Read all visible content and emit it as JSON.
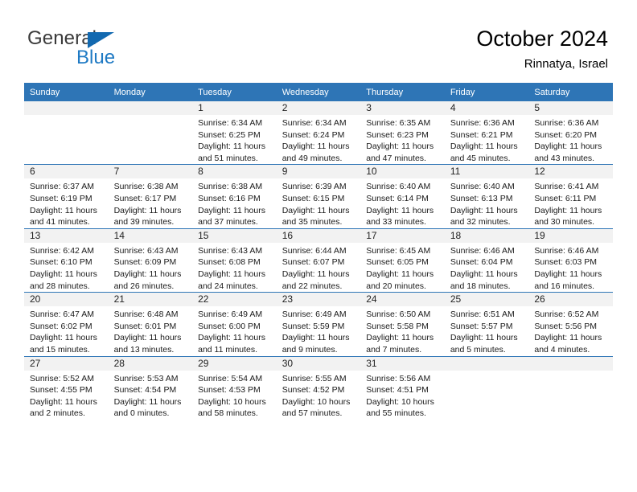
{
  "brand": {
    "name_part1": "General",
    "name_part2": "Blue",
    "triangle_color": "#1269b0",
    "blue_text_color": "#1f7ac4"
  },
  "header": {
    "title": "October 2024",
    "subtitle": "Rinnatya, Israel",
    "accent_color": "#2e75b6",
    "band_color": "#f2f2f2"
  },
  "calendar": {
    "weekday_headers": [
      "Sunday",
      "Monday",
      "Tuesday",
      "Wednesday",
      "Thursday",
      "Friday",
      "Saturday"
    ],
    "weeks": [
      [
        {
          "day": "",
          "empty": true,
          "sunrise": "",
          "sunset": "",
          "daylight_line1": "",
          "daylight_line2": ""
        },
        {
          "day": "",
          "empty": true,
          "sunrise": "",
          "sunset": "",
          "daylight_line1": "",
          "daylight_line2": ""
        },
        {
          "day": "1",
          "empty": false,
          "sunrise": "Sunrise: 6:34 AM",
          "sunset": "Sunset: 6:25 PM",
          "daylight_line1": "Daylight: 11 hours",
          "daylight_line2": "and 51 minutes."
        },
        {
          "day": "2",
          "empty": false,
          "sunrise": "Sunrise: 6:34 AM",
          "sunset": "Sunset: 6:24 PM",
          "daylight_line1": "Daylight: 11 hours",
          "daylight_line2": "and 49 minutes."
        },
        {
          "day": "3",
          "empty": false,
          "sunrise": "Sunrise: 6:35 AM",
          "sunset": "Sunset: 6:23 PM",
          "daylight_line1": "Daylight: 11 hours",
          "daylight_line2": "and 47 minutes."
        },
        {
          "day": "4",
          "empty": false,
          "sunrise": "Sunrise: 6:36 AM",
          "sunset": "Sunset: 6:21 PM",
          "daylight_line1": "Daylight: 11 hours",
          "daylight_line2": "and 45 minutes."
        },
        {
          "day": "5",
          "empty": false,
          "sunrise": "Sunrise: 6:36 AM",
          "sunset": "Sunset: 6:20 PM",
          "daylight_line1": "Daylight: 11 hours",
          "daylight_line2": "and 43 minutes."
        }
      ],
      [
        {
          "day": "6",
          "empty": false,
          "sunrise": "Sunrise: 6:37 AM",
          "sunset": "Sunset: 6:19 PM",
          "daylight_line1": "Daylight: 11 hours",
          "daylight_line2": "and 41 minutes."
        },
        {
          "day": "7",
          "empty": false,
          "sunrise": "Sunrise: 6:38 AM",
          "sunset": "Sunset: 6:17 PM",
          "daylight_line1": "Daylight: 11 hours",
          "daylight_line2": "and 39 minutes."
        },
        {
          "day": "8",
          "empty": false,
          "sunrise": "Sunrise: 6:38 AM",
          "sunset": "Sunset: 6:16 PM",
          "daylight_line1": "Daylight: 11 hours",
          "daylight_line2": "and 37 minutes."
        },
        {
          "day": "9",
          "empty": false,
          "sunrise": "Sunrise: 6:39 AM",
          "sunset": "Sunset: 6:15 PM",
          "daylight_line1": "Daylight: 11 hours",
          "daylight_line2": "and 35 minutes."
        },
        {
          "day": "10",
          "empty": false,
          "sunrise": "Sunrise: 6:40 AM",
          "sunset": "Sunset: 6:14 PM",
          "daylight_line1": "Daylight: 11 hours",
          "daylight_line2": "and 33 minutes."
        },
        {
          "day": "11",
          "empty": false,
          "sunrise": "Sunrise: 6:40 AM",
          "sunset": "Sunset: 6:13 PM",
          "daylight_line1": "Daylight: 11 hours",
          "daylight_line2": "and 32 minutes."
        },
        {
          "day": "12",
          "empty": false,
          "sunrise": "Sunrise: 6:41 AM",
          "sunset": "Sunset: 6:11 PM",
          "daylight_line1": "Daylight: 11 hours",
          "daylight_line2": "and 30 minutes."
        }
      ],
      [
        {
          "day": "13",
          "empty": false,
          "sunrise": "Sunrise: 6:42 AM",
          "sunset": "Sunset: 6:10 PM",
          "daylight_line1": "Daylight: 11 hours",
          "daylight_line2": "and 28 minutes."
        },
        {
          "day": "14",
          "empty": false,
          "sunrise": "Sunrise: 6:43 AM",
          "sunset": "Sunset: 6:09 PM",
          "daylight_line1": "Daylight: 11 hours",
          "daylight_line2": "and 26 minutes."
        },
        {
          "day": "15",
          "empty": false,
          "sunrise": "Sunrise: 6:43 AM",
          "sunset": "Sunset: 6:08 PM",
          "daylight_line1": "Daylight: 11 hours",
          "daylight_line2": "and 24 minutes."
        },
        {
          "day": "16",
          "empty": false,
          "sunrise": "Sunrise: 6:44 AM",
          "sunset": "Sunset: 6:07 PM",
          "daylight_line1": "Daylight: 11 hours",
          "daylight_line2": "and 22 minutes."
        },
        {
          "day": "17",
          "empty": false,
          "sunrise": "Sunrise: 6:45 AM",
          "sunset": "Sunset: 6:05 PM",
          "daylight_line1": "Daylight: 11 hours",
          "daylight_line2": "and 20 minutes."
        },
        {
          "day": "18",
          "empty": false,
          "sunrise": "Sunrise: 6:46 AM",
          "sunset": "Sunset: 6:04 PM",
          "daylight_line1": "Daylight: 11 hours",
          "daylight_line2": "and 18 minutes."
        },
        {
          "day": "19",
          "empty": false,
          "sunrise": "Sunrise: 6:46 AM",
          "sunset": "Sunset: 6:03 PM",
          "daylight_line1": "Daylight: 11 hours",
          "daylight_line2": "and 16 minutes."
        }
      ],
      [
        {
          "day": "20",
          "empty": false,
          "sunrise": "Sunrise: 6:47 AM",
          "sunset": "Sunset: 6:02 PM",
          "daylight_line1": "Daylight: 11 hours",
          "daylight_line2": "and 15 minutes."
        },
        {
          "day": "21",
          "empty": false,
          "sunrise": "Sunrise: 6:48 AM",
          "sunset": "Sunset: 6:01 PM",
          "daylight_line1": "Daylight: 11 hours",
          "daylight_line2": "and 13 minutes."
        },
        {
          "day": "22",
          "empty": false,
          "sunrise": "Sunrise: 6:49 AM",
          "sunset": "Sunset: 6:00 PM",
          "daylight_line1": "Daylight: 11 hours",
          "daylight_line2": "and 11 minutes."
        },
        {
          "day": "23",
          "empty": false,
          "sunrise": "Sunrise: 6:49 AM",
          "sunset": "Sunset: 5:59 PM",
          "daylight_line1": "Daylight: 11 hours",
          "daylight_line2": "and 9 minutes."
        },
        {
          "day": "24",
          "empty": false,
          "sunrise": "Sunrise: 6:50 AM",
          "sunset": "Sunset: 5:58 PM",
          "daylight_line1": "Daylight: 11 hours",
          "daylight_line2": "and 7 minutes."
        },
        {
          "day": "25",
          "empty": false,
          "sunrise": "Sunrise: 6:51 AM",
          "sunset": "Sunset: 5:57 PM",
          "daylight_line1": "Daylight: 11 hours",
          "daylight_line2": "and 5 minutes."
        },
        {
          "day": "26",
          "empty": false,
          "sunrise": "Sunrise: 6:52 AM",
          "sunset": "Sunset: 5:56 PM",
          "daylight_line1": "Daylight: 11 hours",
          "daylight_line2": "and 4 minutes."
        }
      ],
      [
        {
          "day": "27",
          "empty": false,
          "sunrise": "Sunrise: 5:52 AM",
          "sunset": "Sunset: 4:55 PM",
          "daylight_line1": "Daylight: 11 hours",
          "daylight_line2": "and 2 minutes."
        },
        {
          "day": "28",
          "empty": false,
          "sunrise": "Sunrise: 5:53 AM",
          "sunset": "Sunset: 4:54 PM",
          "daylight_line1": "Daylight: 11 hours",
          "daylight_line2": "and 0 minutes."
        },
        {
          "day": "29",
          "empty": false,
          "sunrise": "Sunrise: 5:54 AM",
          "sunset": "Sunset: 4:53 PM",
          "daylight_line1": "Daylight: 10 hours",
          "daylight_line2": "and 58 minutes."
        },
        {
          "day": "30",
          "empty": false,
          "sunrise": "Sunrise: 5:55 AM",
          "sunset": "Sunset: 4:52 PM",
          "daylight_line1": "Daylight: 10 hours",
          "daylight_line2": "and 57 minutes."
        },
        {
          "day": "31",
          "empty": false,
          "sunrise": "Sunrise: 5:56 AM",
          "sunset": "Sunset: 4:51 PM",
          "daylight_line1": "Daylight: 10 hours",
          "daylight_line2": "and 55 minutes."
        },
        {
          "day": "",
          "empty": true,
          "sunrise": "",
          "sunset": "",
          "daylight_line1": "",
          "daylight_line2": ""
        },
        {
          "day": "",
          "empty": true,
          "sunrise": "",
          "sunset": "",
          "daylight_line1": "",
          "daylight_line2": ""
        }
      ]
    ]
  }
}
